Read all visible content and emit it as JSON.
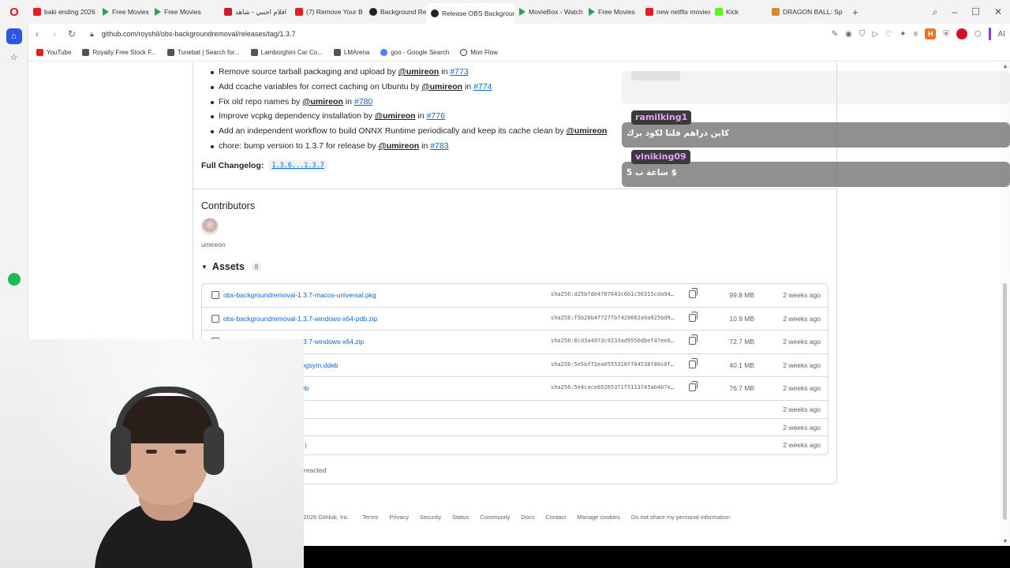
{
  "browser": {
    "tabs": [
      {
        "label": "baki ending 2026 -",
        "icon": "youtube-icon"
      },
      {
        "label": "Free Movies",
        "icon": "play-icon"
      },
      {
        "label": "Free Movies",
        "icon": "play-icon"
      },
      {
        "label": "افلام اجنبي - شاهد",
        "icon": "red-icon"
      },
      {
        "label": "(7) Remove Your B",
        "icon": "youtube-icon"
      },
      {
        "label": "Background Remo",
        "icon": "github-icon"
      },
      {
        "label": "Release OBS Background",
        "icon": "github-icon",
        "active": true
      },
      {
        "label": "MovieBox - Watch",
        "icon": "play-icon"
      },
      {
        "label": "Free Movies",
        "icon": "play-icon"
      },
      {
        "label": "new netflix movies",
        "icon": "youtube-icon"
      },
      {
        "label": "Kick",
        "icon": "kick-icon"
      },
      {
        "label": "DRAGON BALL: Sp",
        "icon": "dragonball-icon"
      }
    ],
    "url": "github.com/royshil/obs-backgroundremoval/releases/tag/1.3.7",
    "bookmarks": [
      {
        "label": "YouTube",
        "icon": "youtube-icon"
      },
      {
        "label": "Royalty Free Stock F...",
        "icon": "page-icon"
      },
      {
        "label": "Tunebat | Search for...",
        "icon": "page-icon"
      },
      {
        "label": "Lamborghini Car Co...",
        "icon": "page-icon"
      },
      {
        "label": "LMArena",
        "icon": "page-icon"
      },
      {
        "label": "goo - Google Search",
        "icon": "google-icon"
      },
      {
        "label": "Mon Flow",
        "icon": "monflow-icon"
      }
    ],
    "ext_h_label": "H",
    "ai_label": "AI"
  },
  "release": {
    "changes": [
      {
        "text": "Remove source tarball packaging and upload by ",
        "user": "@umireon",
        "issue": "#773"
      },
      {
        "text": "Add ccache variables for correct caching on Ubuntu by ",
        "user": "@umireon",
        "issue": "#774"
      },
      {
        "text": "Fix old repo names by ",
        "user": "@umireon",
        "issue": "#780"
      },
      {
        "text": "Improve vcpkg dependency installation by ",
        "user": "@umireon",
        "issue": "#776"
      },
      {
        "text": "Add an independent workflow to build ONNX Runtime periodically and keep its cache clean by ",
        "user": "@umireon",
        "issue": ""
      },
      {
        "text": "chore: bump version to 1.3.7 for release by ",
        "user": "@umireon",
        "issue": "#783"
      }
    ],
    "in_word": " in ",
    "full_changelog_label": "Full Changelog:",
    "full_changelog_value": "1.3.6...1.3.7",
    "contributors_heading": "Contributors",
    "contributor_name": "umireon",
    "assets_heading": "Assets",
    "assets_count": "8",
    "assets": [
      {
        "name": "obs-backgroundremoval-1.3.7-macos-universal.pkg",
        "sha": "sha256:d25b7de4707643c6b1c56315cda94…",
        "size": "99.8 MB",
        "date": "2 weeks ago"
      },
      {
        "name": "obs-backgroundremoval-1.3.7-windows-x64-pdb.zip",
        "sha": "sha256:f5b26b4f727fbf429662a9a925bd9…",
        "size": "10.9 MB",
        "date": "2 weeks ago"
      },
      {
        "name": "obs-backgroundremoval-1.3.7-windows-x64.zip",
        "sha": "sha256:0cd3a4973c9233ad9556dbef47ee0…",
        "size": "72.7 MB",
        "date": "2 weeks ago"
      },
      {
        "name": "l-1.3.7-x86_64-linux-gnu-dbgsym.ddeb",
        "sha": "sha256:5e5bf72ea0555310ff04538f80c0f…",
        "size": "40.1 MB",
        "date": "2 weeks ago"
      },
      {
        "name": "l-1.3.7-x86_64-linux-gnu.deb",
        "sha": "sha256:5e4cace65265371f5113745ab4b7e…",
        "size": "76.7 MB",
        "date": "2 weeks ago"
      }
    ],
    "source_rows": [
      {
        "date": "2 weeks ago",
        "frag": ""
      },
      {
        "date": "2 weeks ago",
        "frag": ""
      },
      {
        "date": "2 weeks ago",
        "frag": ")"
      }
    ],
    "reacted": "reacted"
  },
  "footer": {
    "copyright": "© 2026 GitHub, Inc.",
    "links": [
      "Terms",
      "Privacy",
      "Security",
      "Status",
      "Community",
      "Docs",
      "Contact",
      "Manage cookies",
      "Do not share my personal information"
    ]
  },
  "chat": {
    "messages": [
      {
        "user": "ramilking1",
        "text": "كاين دراهم فلنا لكود برك"
      },
      {
        "user": "viniking09",
        "text": "5 ساعة ب $"
      }
    ]
  }
}
